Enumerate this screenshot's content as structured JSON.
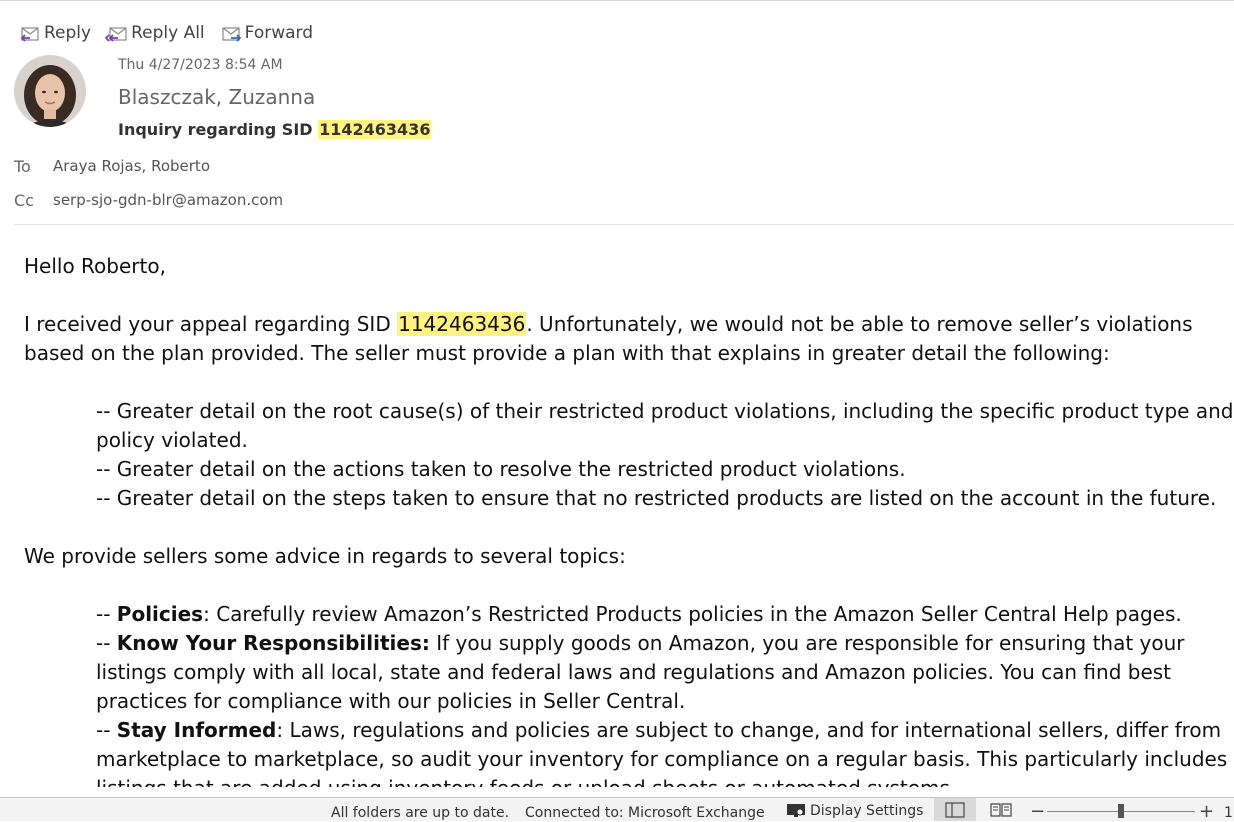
{
  "toolbar": {
    "reply_label": "Reply",
    "reply_all_label": "Reply All",
    "forward_label": "Forward"
  },
  "message": {
    "date": "Thu 4/27/2023 8:54 AM",
    "sender": "Blaszczak, Zuzanna",
    "subject_prefix": "Inquiry regarding SID ",
    "subject_sid": "1142463436",
    "to_label": "To",
    "to_value": "Araya Rojas, Roberto",
    "cc_label": "Cc",
    "cc_value": "serp-sjo-gdn-blr@amazon.com"
  },
  "body": {
    "greeting": "Hello Roberto,",
    "p1_before": "I received your appeal regarding SID ",
    "p1_sid": "1142463436",
    "p1_after": ". Unfortunately, we would not be able to remove seller’s violations based on the plan provided. The seller must provide a plan with that explains in greater detail the following:",
    "list1": [
      "-- Greater detail on the root cause(s) of their restricted product violations, including the specific product type and policy violated.",
      "-- Greater detail on the actions taken to resolve the restricted product violations.",
      "-- Greater detail on the steps taken to ensure that no restricted products are listed on the account in the future."
    ],
    "p2": "We provide sellers some advice in regards to several topics:",
    "list2": [
      {
        "prefix": "-- ",
        "bold": "Policies",
        "text": ": Carefully review Amazon’s Restricted Products policies in the Amazon Seller Central Help pages."
      },
      {
        "prefix": "-- ",
        "bold": "Know Your Responsibilities:",
        "text": " If you supply goods on Amazon, you are responsible for ensuring that your listings comply with all local, state and federal laws and regulations and Amazon policies. You can find best practices for compliance with our policies in Seller Central."
      },
      {
        "prefix": "-- ",
        "bold": "Stay Informed",
        "text": ": Laws, regulations and policies are subject to change, and for international sellers, differ from marketplace to marketplace, so audit your inventory for compliance on a regular basis. This particularly includes listings that are added using inventory feeds or upload sheets or automated systems."
      }
    ]
  },
  "status": {
    "folders": "All folders are up to date.",
    "connection": "Connected to: Microsoft Exchange",
    "display_settings": "Display Settings",
    "zoom_minus": "−",
    "zoom_plus": "+",
    "zoom_value": "1"
  },
  "icons": {
    "reply": "reply-envelope-icon",
    "reply_all": "reply-all-envelope-icon",
    "forward": "forward-envelope-icon"
  }
}
